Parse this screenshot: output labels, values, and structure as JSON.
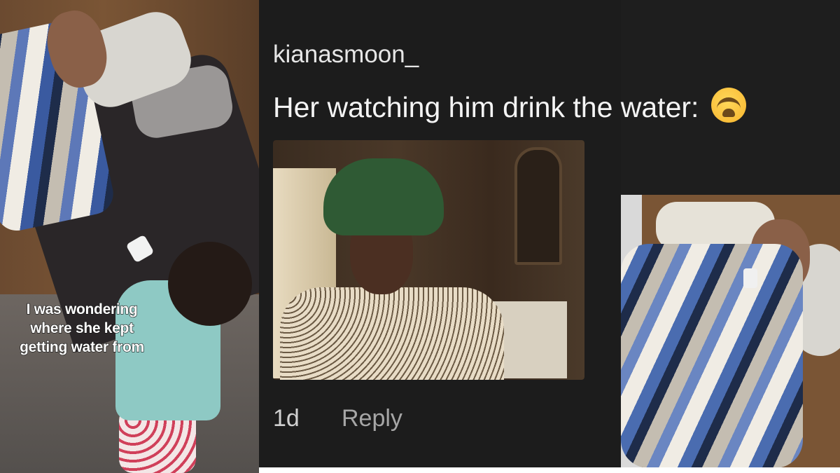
{
  "left_video": {
    "caption": "I was wondering where she kept getting water from"
  },
  "comment": {
    "username": "kianasmoon_",
    "text": "Her watching him drink the water:",
    "emoji": "loudly-crying-face-icon",
    "age": "1d",
    "reply_label": "Reply"
  },
  "colors": {
    "panel_bg": "#1c1c1c",
    "username": "#e6e6e6",
    "text": "#f4f4f4",
    "reply": "#a6a6a6"
  }
}
